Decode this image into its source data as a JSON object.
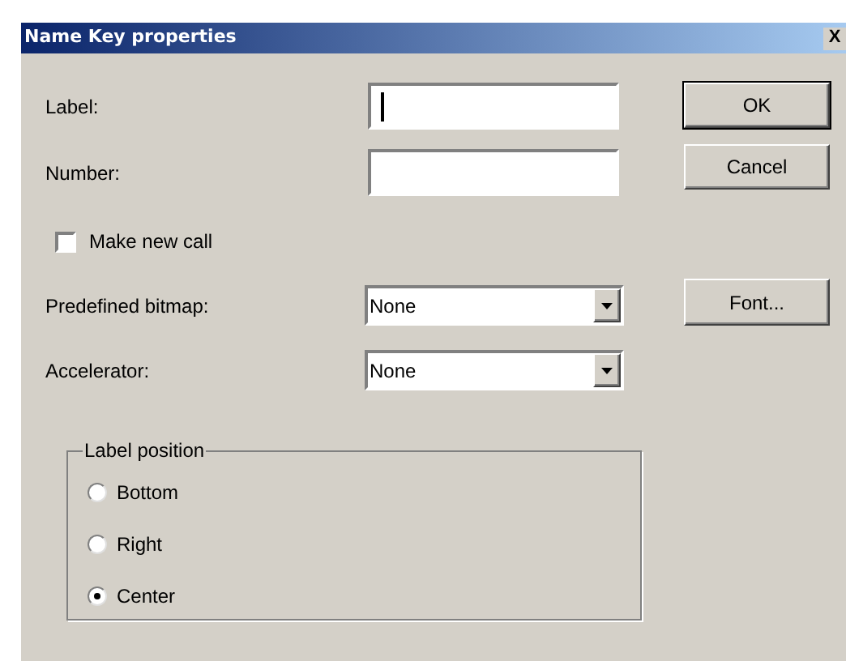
{
  "window": {
    "title": "Name Key properties",
    "close": "X"
  },
  "fields": [
    {
      "label": "Label:",
      "focused": true
    },
    {
      "label": "Number:",
      "focused": false
    }
  ],
  "make_new_call": {
    "label": "Make new call",
    "checked": false
  },
  "dropdowns": [
    {
      "label": "Predefined bitmap:",
      "value": "None"
    },
    {
      "label": "Accelerator:",
      "value": "None"
    }
  ],
  "buttons": [
    "OK",
    "Cancel",
    "Font..."
  ],
  "label_position": {
    "title": "Label position",
    "options": [
      {
        "label": "Bottom",
        "selected": false
      },
      {
        "label": "Right",
        "selected": false
      },
      {
        "label": "Center",
        "selected": true
      }
    ]
  }
}
